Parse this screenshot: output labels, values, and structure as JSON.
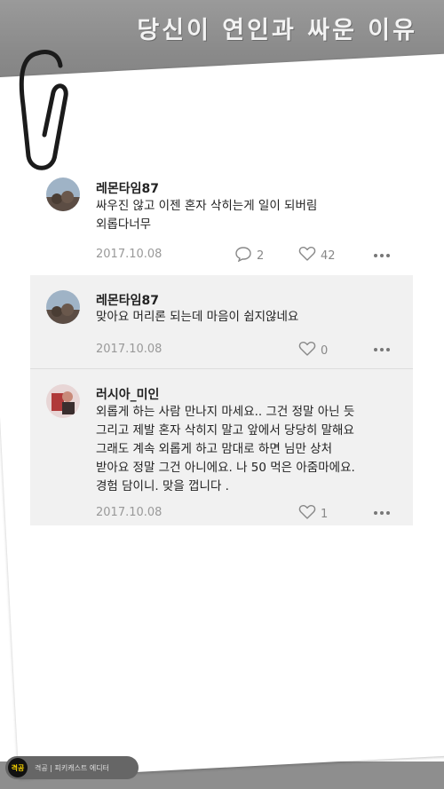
{
  "title": "당신이 연인과 싸운 이유",
  "comments": [
    {
      "username": "레몬타임87",
      "text": "싸우진 않고 이젠 혼자 삭히는게 일이 되버림\n외롭다너무",
      "date": "2017.10.08",
      "reply_count": "2",
      "like_count": "42"
    },
    {
      "username": "레몬타임87",
      "text": "맞아요 머리론 되는데 마음이 쉽지않네요",
      "date": "2017.10.08",
      "like_count": "0"
    },
    {
      "username": "러시아_미인",
      "text": "외롭게 하는 사람 만나지 마세요.. 그건 정말 아닌 듯\n그리고 제발 혼자 삭히지 말고 앞에서 당당히 말해요\n그래도 계속 외롭게 하고 맘대로 하면 님만 상처\n받아요 정말 그건 아니에요. 나 50 먹은 아줌마에요.\n경험 담이니. 맞을 껍니다 .",
      "date": "2017.10.08",
      "like_count": "1"
    }
  ],
  "footer": {
    "logo_text": "격공",
    "text": "격공 | 피키캐스트 에디터"
  },
  "colors": {
    "band": "#8a8a8a",
    "reply_bg": "#f1f1f1",
    "logo_yellow": "#f5d000"
  },
  "icons": [
    "paperclip-icon",
    "comment-bubble-icon",
    "heart-icon",
    "more-dots-icon"
  ]
}
